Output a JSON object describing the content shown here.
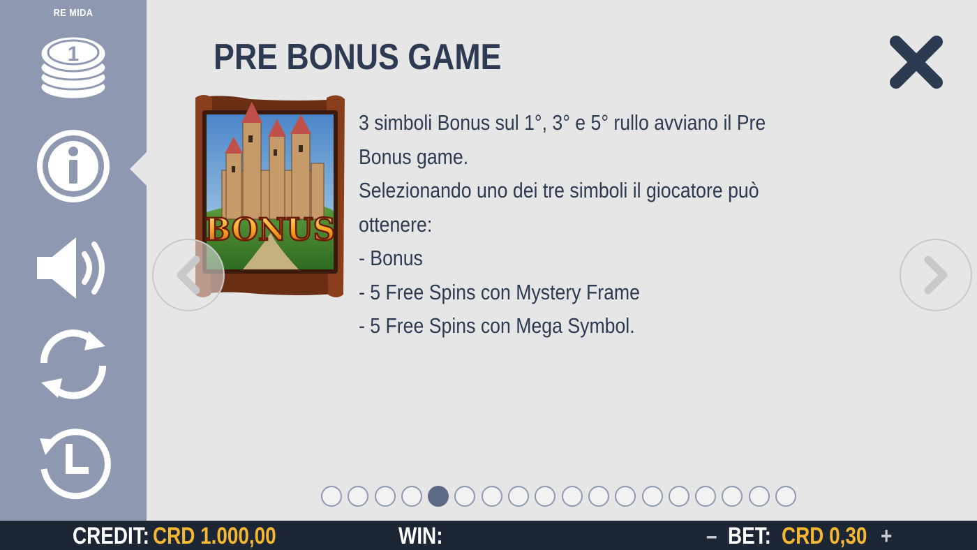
{
  "game_title": "RE MIDA",
  "sidebar": {
    "items": [
      {
        "name": "paytable",
        "icon": "coin-stack-icon"
      },
      {
        "name": "info",
        "icon": "info-icon",
        "active": true
      },
      {
        "name": "sound",
        "icon": "speaker-icon"
      },
      {
        "name": "autoplay",
        "icon": "refresh-icon"
      },
      {
        "name": "history",
        "icon": "clock-icon"
      }
    ],
    "coin_label": "1"
  },
  "page": {
    "title": "PRE BONUS GAME",
    "symbol_label": "BONUS",
    "description": [
      "3 simboli Bonus sul 1°, 3° e 5° rullo avviano il Pre Bonus game.",
      "Selezionando uno dei tre simboli il giocatore può ottenere:",
      "- Bonus",
      "- 5 Free Spins con Mystery Frame",
      "- 5 Free Spins con Mega Symbol."
    ]
  },
  "pagination": {
    "total": 18,
    "current": 5
  },
  "bottom_bar": {
    "credit_label": "CREDIT:",
    "credit_value": "CRD 1.000,00",
    "win_label": "WIN:",
    "win_value": "",
    "bet_minus": "–",
    "bet_label": "BET:",
    "bet_value": "CRD 0,30",
    "bet_plus": "+"
  },
  "colors": {
    "sidebar_bg": "#8e99b1",
    "content_bg": "#e6e6e6",
    "heading": "#2c3a52",
    "bottom_bg": "#1d2634",
    "value_accent": "#f5b830"
  }
}
